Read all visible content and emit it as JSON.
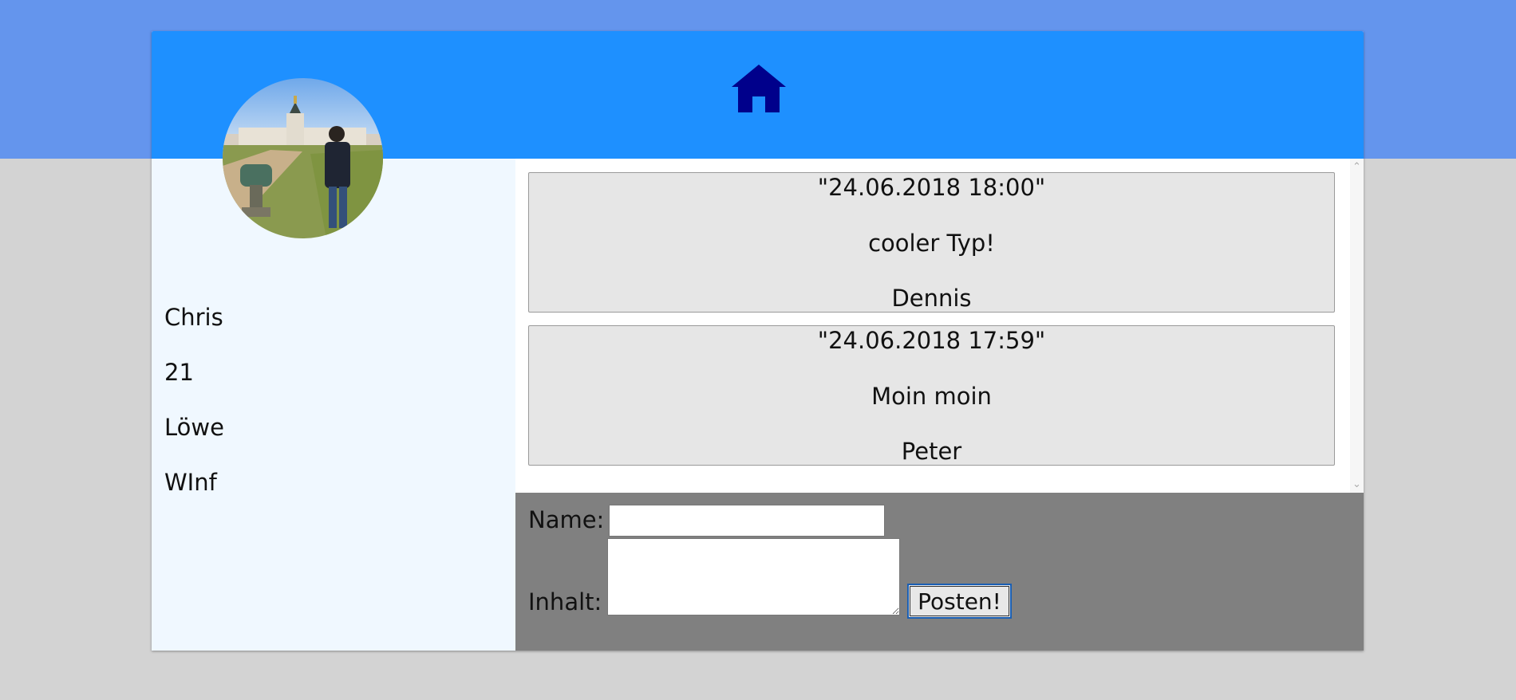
{
  "header": {
    "home_icon": "home-icon",
    "color": "#1e90ff",
    "icon_color": "#00008b"
  },
  "profile": {
    "avatar_icon": "profile-photo",
    "name": "Chris",
    "age": "21",
    "zodiac": "Löwe",
    "major": "WInf"
  },
  "posts": [
    {
      "timestamp": "\"24.06.2018 18:00\"",
      "content": "cooler Typ!",
      "author": "Dennis"
    },
    {
      "timestamp": "\"24.06.2018 17:59\"",
      "content": "Moin moin",
      "author": "Peter"
    }
  ],
  "form": {
    "name_label": "Name:",
    "name_value": "",
    "content_label": "Inhalt:",
    "content_value": "",
    "submit_label": "Posten!"
  }
}
